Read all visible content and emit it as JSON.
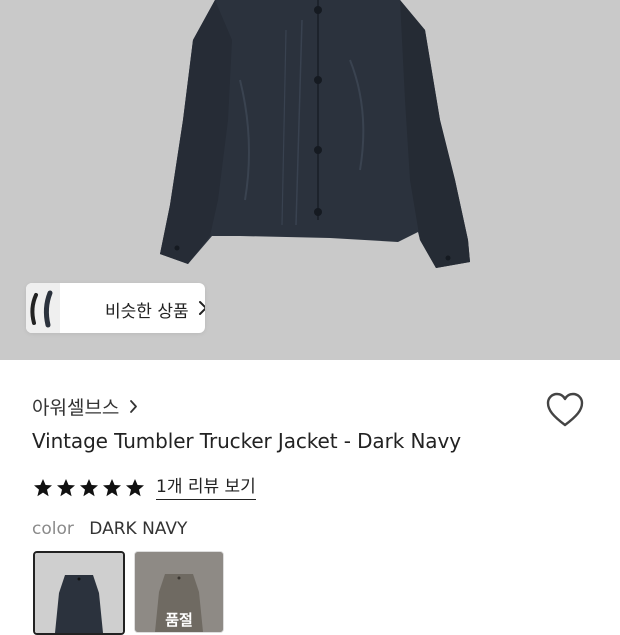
{
  "similar_products": {
    "label": "비슷한 상품"
  },
  "brand": {
    "name": "아워셀브스"
  },
  "product": {
    "title": "Vintage Tumbler Trucker Jacket - Dark Navy"
  },
  "rating": {
    "stars": 5,
    "review_link": "1개 리뷰 보기"
  },
  "color_option": {
    "label": "color",
    "value": "DARK NAVY"
  },
  "swatches": [
    {
      "name": "DARK NAVY",
      "selected": true,
      "color": "#2b323d"
    },
    {
      "name": "",
      "selected": false,
      "color": "#6f6a62",
      "overlay_text": "품절"
    }
  ],
  "colors": {
    "background_hero": "#c9c9c9",
    "jacket": "#2b323d",
    "text": "#222222",
    "muted": "#8a8a8a"
  }
}
